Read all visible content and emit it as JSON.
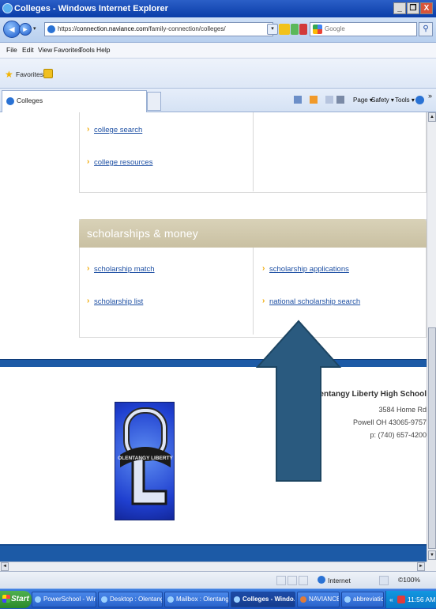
{
  "window": {
    "title": "Colleges - Windows Internet Explorer",
    "buttons": [
      "_",
      "❐",
      "X"
    ]
  },
  "address_bar": {
    "url_prefix": "https://",
    "url_host": "connection.naviance.com",
    "url_path": "/family-connection/colleges/",
    "search_placeholder": "Google"
  },
  "menu": [
    "File",
    "Edit",
    "View",
    "Favorites",
    "Tools",
    "Help"
  ],
  "favorites": {
    "label": "Favorites"
  },
  "tab": {
    "title": "Colleges"
  },
  "command_bar": {
    "page": "Page ▾",
    "safety": "Safety ▾",
    "tools": "Tools ▾"
  },
  "page": {
    "colleges_links": [
      "college search",
      "college resources"
    ],
    "scholarships": {
      "title": "scholarships & money",
      "left_links": [
        "scholarship match",
        "scholarship list"
      ],
      "right_links": [
        "scholarship applications",
        "national scholarship search"
      ]
    },
    "school": {
      "name": "Olentangy Liberty High School",
      "address_line": "3584 Home Rd",
      "city_line": "Powell OH 43065-9757",
      "phone": "p: (740) 657-4200"
    },
    "logo_text": "OLENTANGY LIBERTY"
  },
  "status_bar": {
    "zone": "Internet",
    "zoom": "©100%"
  },
  "taskbar": {
    "start": "Start",
    "tasks": [
      "PowerSchool - Wind...",
      "Desktop : Olentang...",
      "Mailbox : Olentang...",
      "Colleges - Windo...",
      "NAVIANCE PowerPoint",
      "abbreviations for ex..."
    ],
    "clock": "11:56 AM"
  },
  "colors": {
    "arrow": "#2a5a7f",
    "band": "#1c5aa6",
    "header": "#cfc7a9",
    "link": "#1d4fa3"
  }
}
